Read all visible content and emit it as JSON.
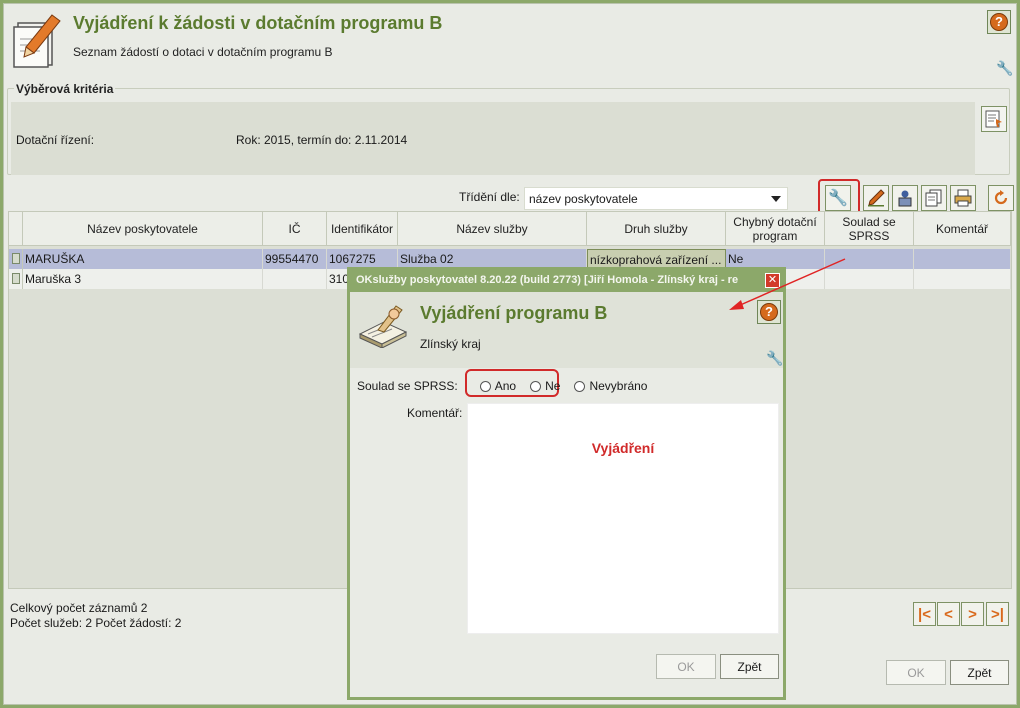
{
  "header": {
    "title": "Vyjádření k žádosti v dotačním programu B",
    "subtitle": "Seznam žádostí o dotaci v dotačním programu B",
    "help_icon": "question-mark"
  },
  "criteria": {
    "legend": "Výběrová kritéria",
    "label": "Dotační řízení:",
    "value": "Rok: 2015, termín do: 2.11.2014"
  },
  "sort": {
    "label": "Třídění dle:",
    "value": "název poskytovatele"
  },
  "table": {
    "columns": [
      "Název poskytovatele",
      "IČ",
      "Identifikátor",
      "Název služby",
      "Druh služby",
      "Chybný dotační program",
      "Soulad se SPRSS",
      "Komentář"
    ],
    "rows": [
      [
        "MARUŠKA",
        "99554470",
        "1067275",
        "Služba 02",
        "nízkoprahová zařízení ...",
        "Ne",
        "",
        ""
      ],
      [
        "Maruška 3",
        "",
        "310",
        "",
        "",
        "",
        "",
        ""
      ]
    ]
  },
  "footer": {
    "total": "Celkový počet záznamů 2",
    "counts": "Počet služeb: 2 Počet žádostí: 2",
    "ok_label": "OK",
    "back_label": "Zpět"
  },
  "dialog": {
    "window_title": "OKslužby poskytovatel 8.20.22 (build 2773)  [Jiří Homola - Zlínský kraj - re",
    "title": "Vyjádření programu B",
    "subtitle": "Zlínský kraj",
    "soulad_label": "Soulad se SPRSS:",
    "options": [
      "Ano",
      "Ne",
      "Nevybráno"
    ],
    "comment_label": "Komentář:",
    "comment_text": "Vyjádření",
    "ok_label": "OK",
    "back_label": "Zpět"
  },
  "colors": {
    "accent_green": "#5b7b2f",
    "frame_green": "#8ca86a",
    "highlight_red": "#d12a2a",
    "selected_row": "#b6bcd8"
  }
}
